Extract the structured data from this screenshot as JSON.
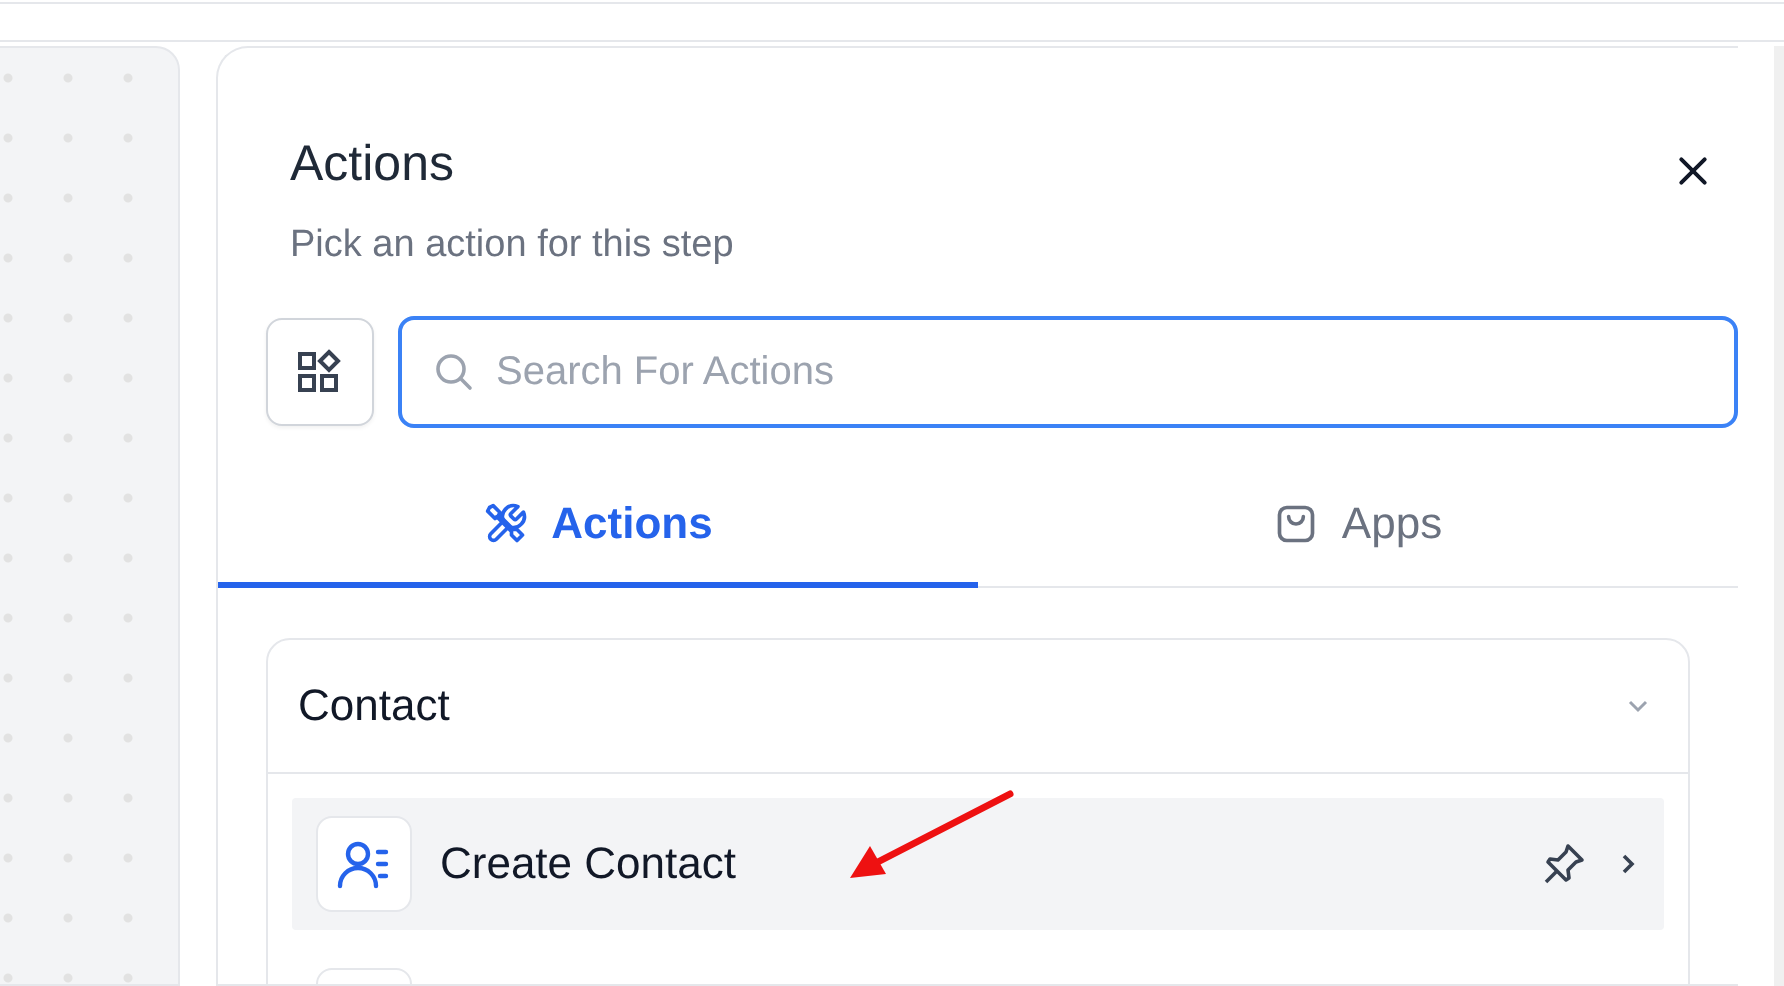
{
  "panel": {
    "title": "Actions",
    "subtitle": "Pick an action for this step"
  },
  "search": {
    "placeholder": "Search For Actions"
  },
  "tabs": [
    {
      "label": "Actions",
      "kind": "tools",
      "selected": true
    },
    {
      "label": "Apps",
      "kind": "bag",
      "selected": false
    }
  ],
  "section": {
    "title": "Contact",
    "expanded": true,
    "items": [
      {
        "label": "Create Contact",
        "selected": true
      },
      {
        "selected": false
      }
    ]
  }
}
